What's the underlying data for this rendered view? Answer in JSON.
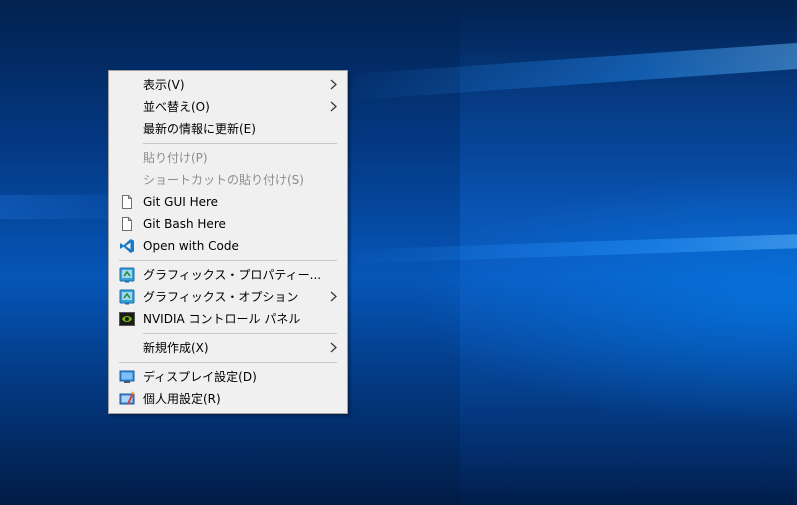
{
  "desktop": {
    "accent": "#0656b8"
  },
  "menu": {
    "group1": [
      {
        "label": "表示(V)",
        "submenu": true
      },
      {
        "label": "並べ替え(O)",
        "submenu": true
      },
      {
        "label": "最新の情報に更新(E)",
        "submenu": false
      }
    ],
    "group2": [
      {
        "label": "貼り付け(P)",
        "disabled": true
      },
      {
        "label": "ショートカットの貼り付け(S)",
        "disabled": true
      },
      {
        "label": "Git GUI Here",
        "icon": "document-icon"
      },
      {
        "label": "Git Bash Here",
        "icon": "document-icon"
      },
      {
        "label": "Open with Code",
        "icon": "vscode-icon"
      }
    ],
    "group3": [
      {
        "label": "グラフィックス・プロパティー...",
        "icon": "intel-graphics-icon"
      },
      {
        "label": "グラフィックス・オプション",
        "icon": "intel-graphics-icon",
        "submenu": true
      },
      {
        "label": "NVIDIA コントロール パネル",
        "icon": "nvidia-icon"
      }
    ],
    "group4": [
      {
        "label": "新規作成(X)",
        "submenu": true
      }
    ],
    "group5": [
      {
        "label": "ディスプレイ設定(D)",
        "icon": "display-icon"
      },
      {
        "label": "個人用設定(R)",
        "icon": "personalize-icon"
      }
    ]
  }
}
